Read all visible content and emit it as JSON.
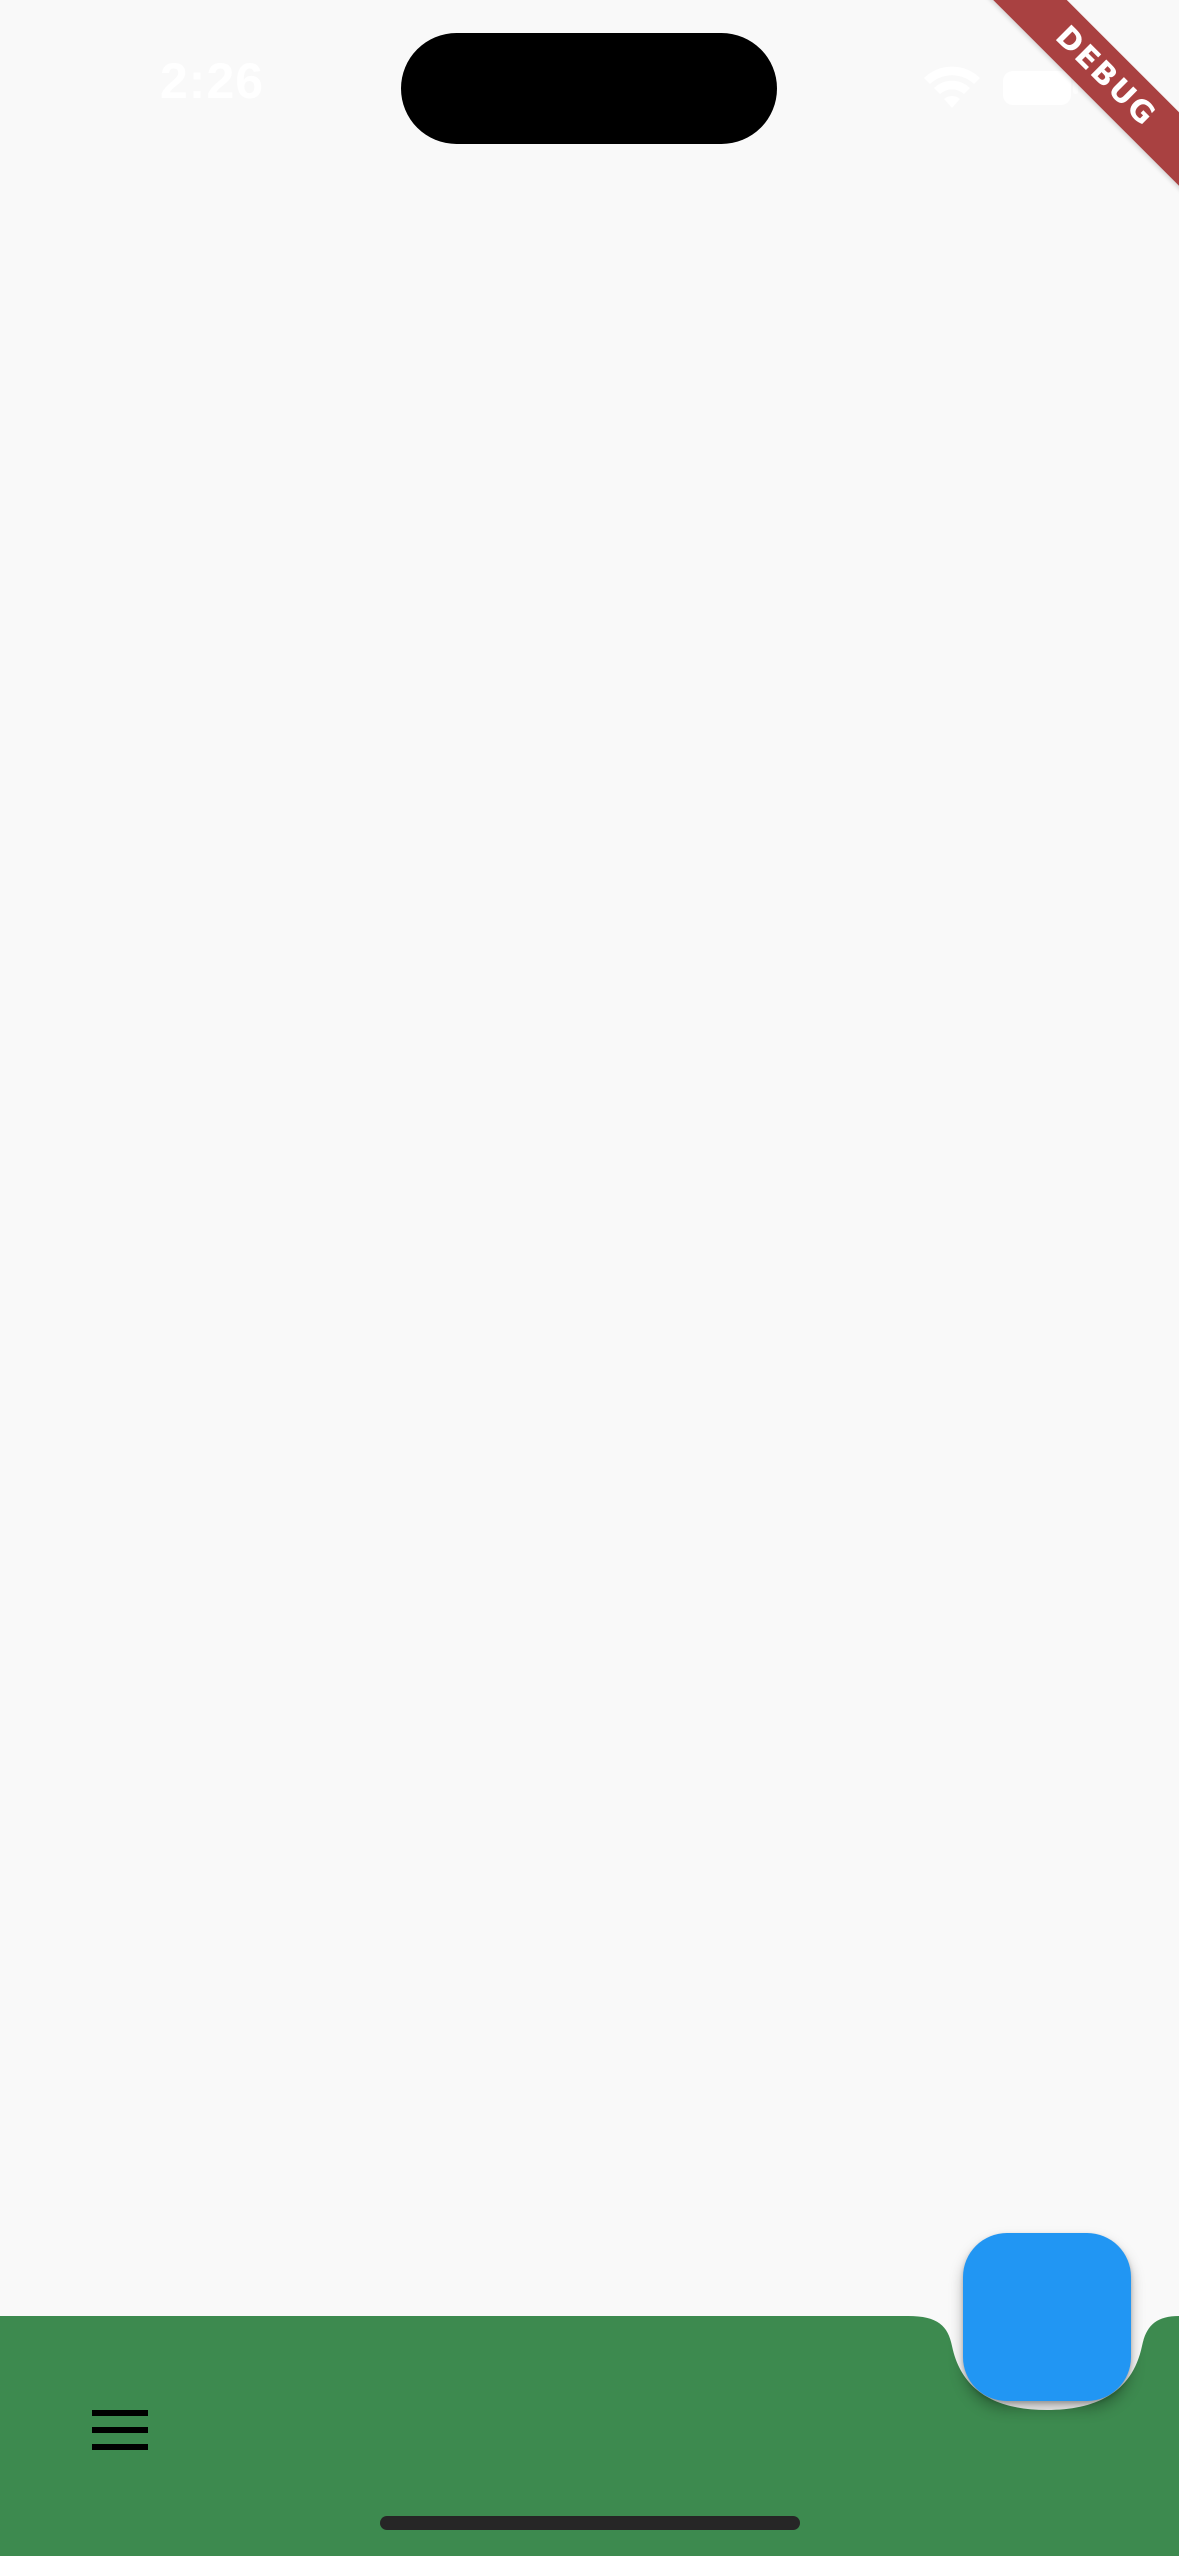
{
  "status_bar": {
    "time": "2:26",
    "icons": [
      "wifi-icon",
      "battery-icon"
    ]
  },
  "debug_banner": {
    "label": "DEBUG"
  },
  "bottom_app_bar": {
    "menu_icon": "menu-icon"
  },
  "colors": {
    "background": "#f9f9f9",
    "bottom_bar": "#3d8a4f",
    "fab": "#2196f3",
    "debug_banner": "#a94141",
    "home_indicator": "#262626"
  }
}
